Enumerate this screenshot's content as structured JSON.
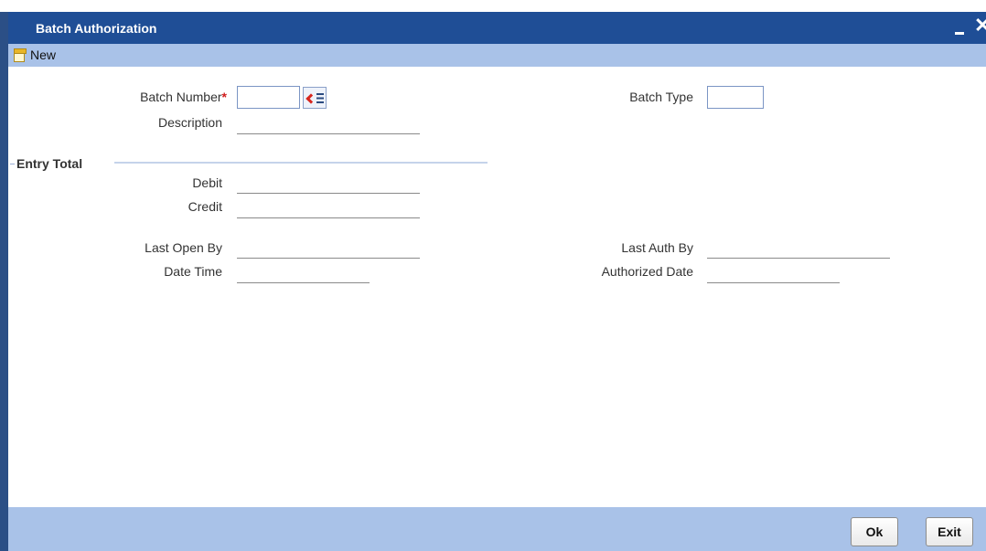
{
  "window": {
    "title": "Batch Authorization"
  },
  "toolbar": {
    "new_label": "New"
  },
  "form": {
    "batch_number": {
      "label": "Batch Number",
      "required_mark": "*",
      "value": ""
    },
    "batch_type": {
      "label": "Batch Type",
      "value": ""
    },
    "description": {
      "label": "Description",
      "value": ""
    },
    "entry_total": {
      "section_label": "Entry Total",
      "debit": {
        "label": "Debit",
        "value": ""
      },
      "credit": {
        "label": "Credit",
        "value": ""
      }
    },
    "last_open_by": {
      "label": "Last Open By",
      "value": ""
    },
    "date_time": {
      "label": "Date Time",
      "value": ""
    },
    "last_auth_by": {
      "label": "Last Auth By",
      "value": ""
    },
    "authorized_date": {
      "label": "Authorized Date",
      "value": ""
    }
  },
  "footer": {
    "ok_label": "Ok",
    "exit_label": "Exit"
  },
  "colors": {
    "title_bar": "#1f4e96",
    "toolbar_bg": "#a9c2e8",
    "required": "#d01c1c"
  },
  "icons": [
    "new-document-icon",
    "lov-search-icon",
    "minimize-icon",
    "close-icon"
  ]
}
